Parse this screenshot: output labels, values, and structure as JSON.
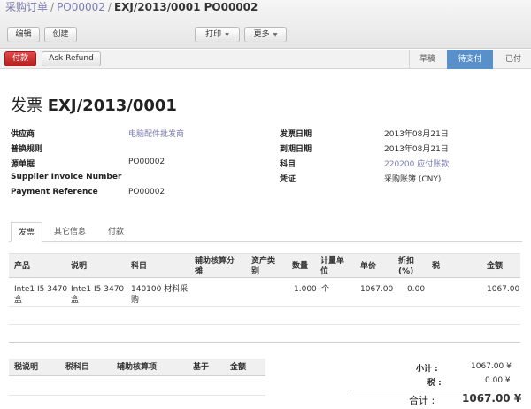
{
  "breadcrumb": {
    "root": "采购订单",
    "po": "PO00002",
    "current": "EXJ/2013/0001 PO00002",
    "sep": "/"
  },
  "toolbar": {
    "edit": "编辑",
    "create": "创建",
    "print": "打印",
    "more": "更多"
  },
  "statusbar": {
    "pay_button": "付款",
    "refund_button": "Ask Refund",
    "stages": [
      "草稿",
      "待支付",
      "已付"
    ],
    "active_stage": 1
  },
  "invoice": {
    "title_prefix": "发票",
    "number": "EXJ/2013/0001",
    "fields_left": [
      {
        "label": "供应商",
        "value": "电脑配件批发商",
        "link": true
      },
      {
        "label": "普换规则",
        "value": ""
      },
      {
        "label": "源单据",
        "value": "PO00002"
      },
      {
        "label": "Supplier Invoice Number",
        "value": ""
      },
      {
        "label": "Payment Reference",
        "value": "PO00002"
      }
    ],
    "fields_right": [
      {
        "label": "发票日期",
        "value": "2013年08月21日"
      },
      {
        "label": "到期日期",
        "value": "2013年08月21日"
      },
      {
        "label": "科目",
        "value": "220200 应付账款",
        "link": true
      },
      {
        "label": "凭证",
        "value": "采购账簿 (CNY)"
      }
    ]
  },
  "tabs": [
    "发票",
    "其它信息",
    "付款"
  ],
  "lines": {
    "headers": {
      "product": "产品",
      "desc": "说明",
      "account": "科目",
      "analytic_1": "辅助核算分",
      "analytic_2": "摊",
      "asset_1": "资产类",
      "asset_2": "别",
      "qty": "数量",
      "uom_1": "计量单",
      "uom_2": "位",
      "price": "单价",
      "discount_1": "折扣",
      "discount_2": "(%)",
      "tax": "税",
      "amount": "金额"
    },
    "rows": [
      {
        "product_1": "Inte1 I5 3470",
        "product_2": "盒",
        "desc_1": "Inte1 I5 3470",
        "desc_2": "盒",
        "account_1": "140100 材料采",
        "account_2": "购",
        "qty": "1.000",
        "uom": "个",
        "price": "1067.00",
        "discount": "0.00",
        "amount": "1067.00"
      }
    ]
  },
  "tax_table": {
    "headers": [
      "税说明",
      "税科目",
      "辅助核算项",
      "基于",
      "金额"
    ]
  },
  "totals": {
    "subtotal_label": "小计 :",
    "subtotal": "1067.00 ¥",
    "tax_label": "税 :",
    "tax": "0.00 ¥",
    "total_label": "合计 :",
    "total": "1067.00 ¥"
  }
}
